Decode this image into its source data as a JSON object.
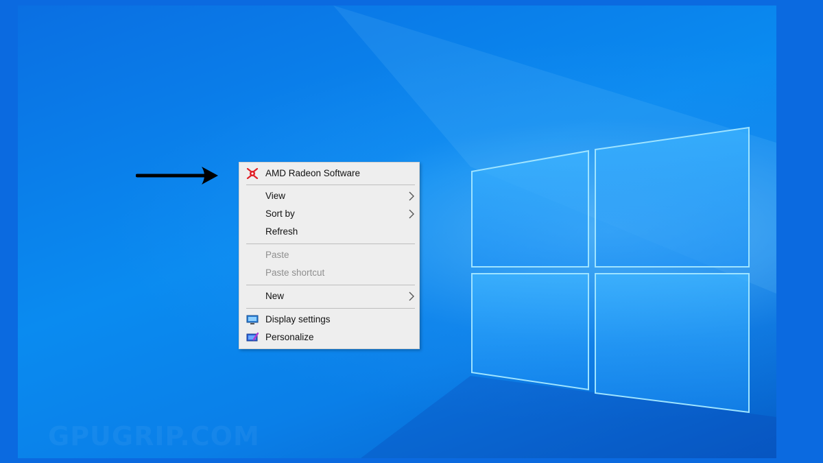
{
  "menu": {
    "items": [
      {
        "label": "AMD Radeon Software",
        "icon": "amd-radeon-icon",
        "enabled": true
      },
      {
        "label": "View",
        "submenu": true,
        "enabled": true
      },
      {
        "label": "Sort by",
        "submenu": true,
        "enabled": true
      },
      {
        "label": "Refresh",
        "enabled": true
      },
      {
        "label": "Paste",
        "enabled": false
      },
      {
        "label": "Paste shortcut",
        "enabled": false
      },
      {
        "label": "New",
        "submenu": true,
        "enabled": true
      },
      {
        "label": "Display settings",
        "icon": "display-settings-icon",
        "enabled": true
      },
      {
        "label": "Personalize",
        "icon": "personalize-icon",
        "enabled": true
      }
    ]
  },
  "watermark": "GPUGRIP.COM",
  "colors": {
    "desktop_blue": "#0a7fe8",
    "menu_background": "#eeeeee",
    "amd_red": "#e01e26",
    "arrow": "#000000"
  }
}
